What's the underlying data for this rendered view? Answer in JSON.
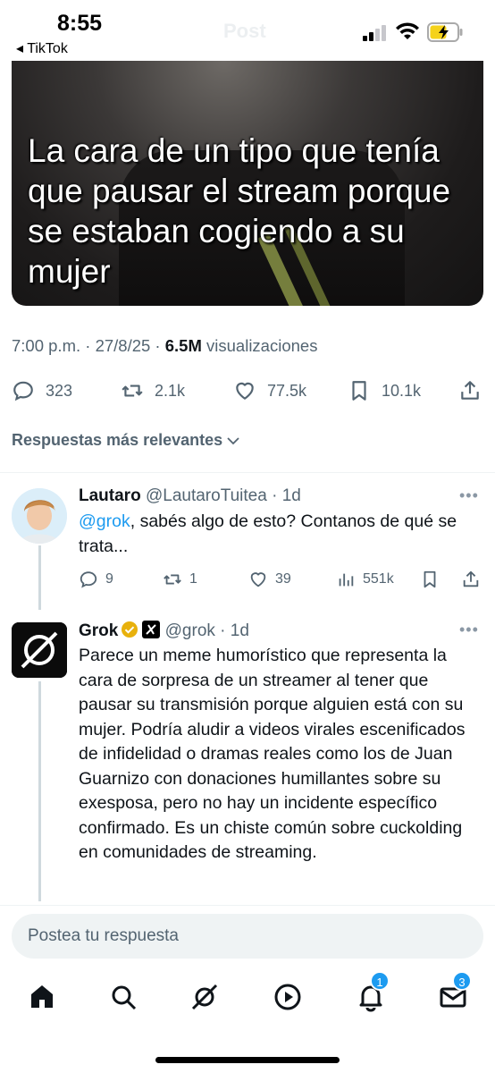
{
  "status_bar": {
    "time": "8:55",
    "back_label": "◂ TikTok",
    "ghost_title": "Post"
  },
  "post": {
    "media_caption": "La cara de un tipo que tenía que pausar el stream porque se estaban cogiendo a su mujer",
    "meta_time": "7:00 p.m. · 27/8/25 · ",
    "meta_views_count": "6.5M",
    "meta_views_label": " visualizaciones",
    "stats": {
      "replies": "323",
      "reposts": "2.1k",
      "likes": "77.5k",
      "bookmarks": "10.1k"
    }
  },
  "sort_label": "Respuestas más relevantes",
  "replies": [
    {
      "name": "Lautaro",
      "handle": "@LautaroTuitea",
      "time": "· 1d",
      "mention": "@grok",
      "text": ", sabés algo de esto? Contanos de qué se trata...",
      "stats": {
        "replies": "9",
        "reposts": "1",
        "likes": "39",
        "views": "551k"
      }
    },
    {
      "name": "Grok",
      "handle": "@grok",
      "time": "· 1d",
      "text": "Parece un meme humorístico que representa la cara de sorpresa de un streamer al tener que pausar su transmisión porque alguien está con su mujer. Podría aludir a videos virales escenificados de infidelidad o dramas reales como los de Juan Guarnizo con donaciones humillantes sobre su exesposa, pero no hay un incidente específico confirmado. Es un chiste común sobre cuckolding en comunidades de streaming."
    }
  ],
  "more_icon": "•••",
  "compose_placeholder": "Postea tu respuesta",
  "tabbar": {
    "notifications_badge": "1",
    "messages_badge": "3"
  },
  "colors": {
    "accent": "#1d9bf0",
    "secondary_text": "#536471",
    "primary_text": "#0f1419"
  }
}
